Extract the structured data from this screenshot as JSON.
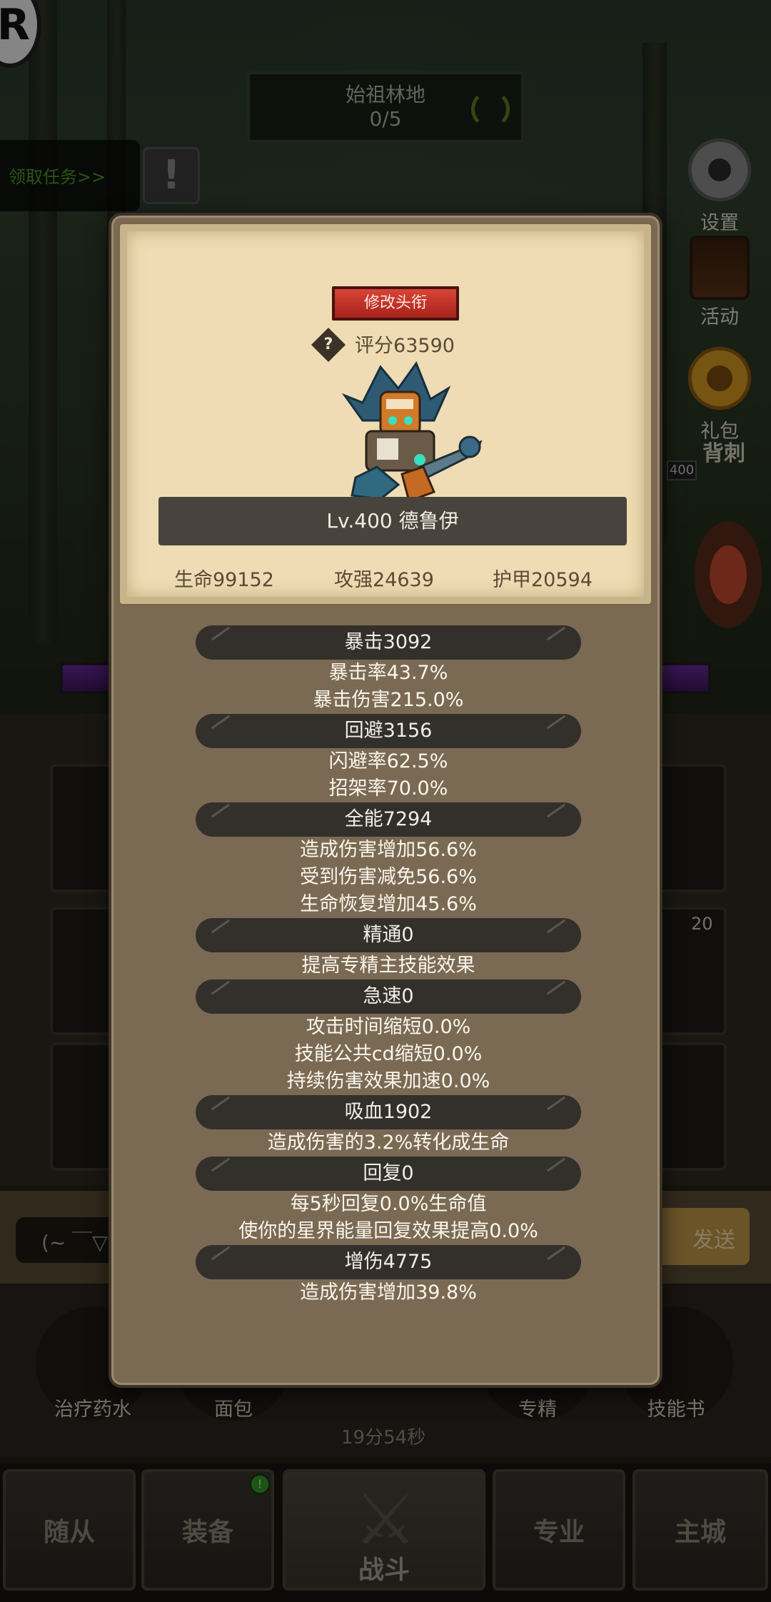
{
  "background": {
    "map_name": "始祖林地",
    "map_progress": "0/5",
    "quest_link": "领取任务>>",
    "quest_icon": "!",
    "side_buttons": [
      "设置",
      "活动",
      "礼包"
    ],
    "backstab": "背刺",
    "level_badge": "400",
    "slot_count": "20",
    "chat_placeholder": "(~ ￣▽",
    "send_label": "发送",
    "quick_items": [
      "治疗药水",
      "面包",
      "专精",
      "技能书"
    ],
    "timer": "19分54秒",
    "nav": [
      "随从",
      "装备",
      "战斗",
      "专业",
      "主城"
    ],
    "logo_text": "R"
  },
  "modal": {
    "title_button": "修改头衔",
    "score_icon": "?",
    "score": "评分63590",
    "hero_name": "Lv.400 德鲁伊",
    "base_stats": [
      "生命99152",
      "攻强24639",
      "护甲20594"
    ],
    "sections": [
      {
        "header": "暴击3092",
        "lines": [
          "暴击率43.7%",
          "暴击伤害215.0%"
        ]
      },
      {
        "header": "回避3156",
        "lines": [
          "闪避率62.5%",
          "招架率70.0%"
        ]
      },
      {
        "header": "全能7294",
        "lines": [
          "造成伤害增加56.6%",
          "受到伤害减免56.6%",
          "生命恢复增加45.6%"
        ]
      },
      {
        "header": "精通0",
        "lines": [
          "提高专精主技能效果"
        ]
      },
      {
        "header": "急速0",
        "lines": [
          "攻击时间缩短0.0%",
          "技能公共cd缩短0.0%",
          "持续伤害效果加速0.0%"
        ]
      },
      {
        "header": "吸血1902",
        "lines": [
          "造成伤害的3.2%转化成生命"
        ]
      },
      {
        "header": "回复0",
        "lines": [
          "每5秒回复0.0%生命值",
          "使你的星界能量回复效果提高0.0%"
        ]
      },
      {
        "header": "增伤4775",
        "lines": [
          "造成伤害增加39.8%"
        ]
      }
    ]
  },
  "colors": {
    "title_button": "#c8322a",
    "stat_header_bg": "#33302b",
    "modal_bg": "#7a6a54",
    "card_bg": "#efdcb4"
  }
}
